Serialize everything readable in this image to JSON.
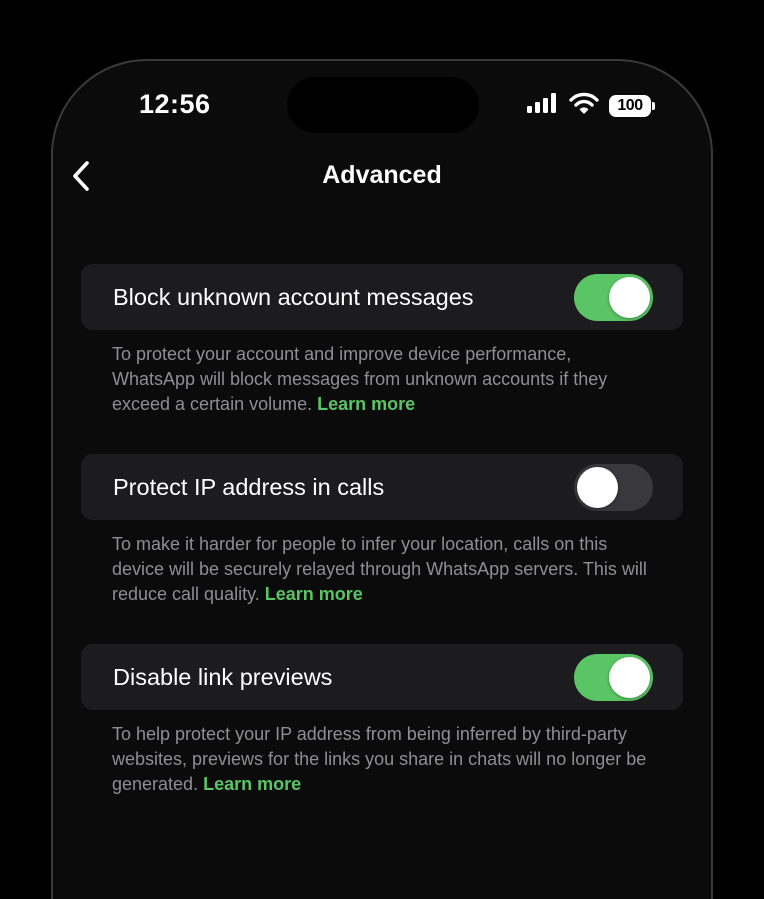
{
  "status_bar": {
    "time": "12:56",
    "battery": "100"
  },
  "nav": {
    "title": "Advanced"
  },
  "settings": [
    {
      "label": "Block unknown account messages",
      "enabled": true,
      "description": "To protect your account and improve device performance, WhatsApp will block messages from unknown accounts if they exceed a certain volume.",
      "link": "Learn more"
    },
    {
      "label": "Protect IP address in calls",
      "enabled": false,
      "description": "To make it harder for people to infer your location, calls on this device will be securely relayed through WhatsApp servers. This will reduce call quality.",
      "link": "Learn more"
    },
    {
      "label": "Disable link previews",
      "enabled": true,
      "description": "To help protect your IP address from being inferred by third-party websites, previews for the links you share in chats will no longer be generated.",
      "link": "Learn more"
    }
  ],
  "colors": {
    "accent": "#5ac565",
    "toggle_off": "#39393d",
    "row_background": "#1c1c1e",
    "secondary_text": "#8e8e93"
  }
}
